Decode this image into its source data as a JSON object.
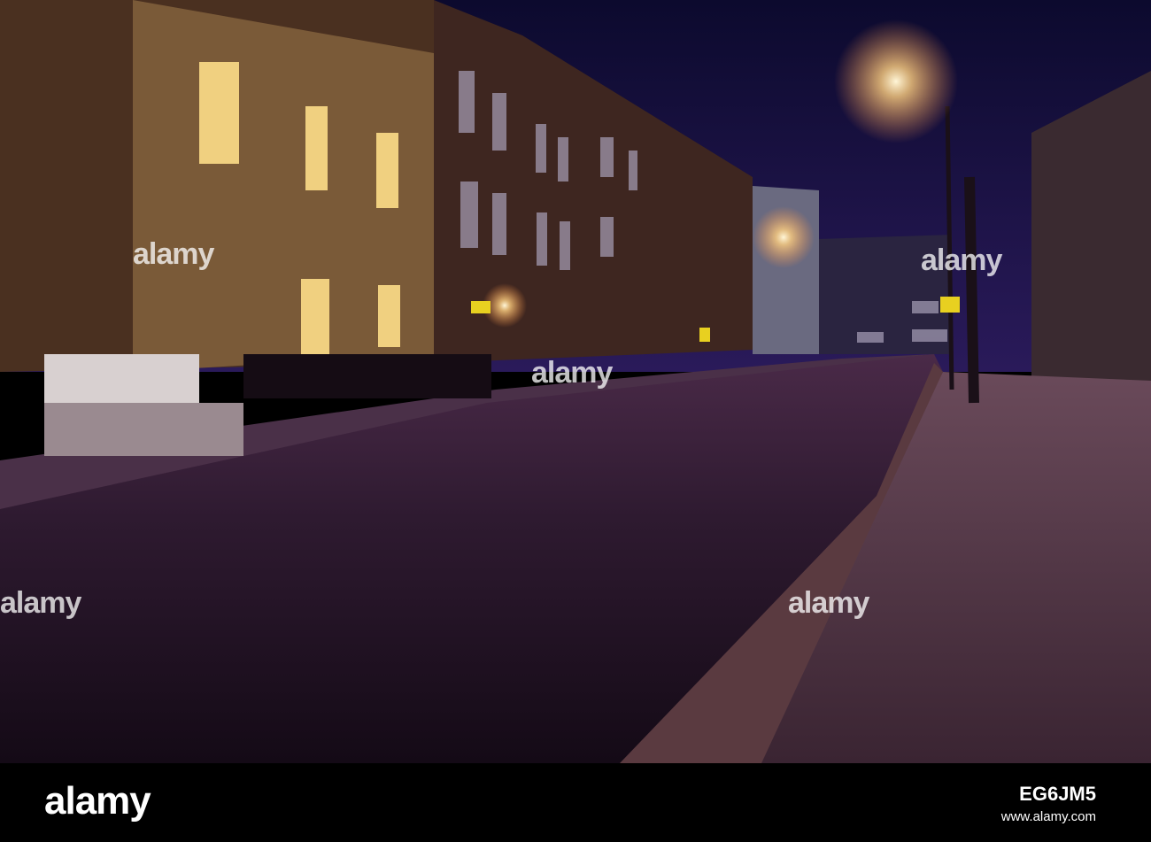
{
  "photo": {
    "subject": "street-at-night",
    "colors": {
      "sky": "#15103a",
      "road": "#2a1628",
      "brick": "#6a4a30",
      "lamp": "#ffe6b0",
      "pavement": "#5a4050"
    }
  },
  "watermark": {
    "text": "alamy"
  },
  "footer": {
    "logo": "alamy",
    "image_id": "EG6JM5",
    "website": "www.alamy.com"
  }
}
